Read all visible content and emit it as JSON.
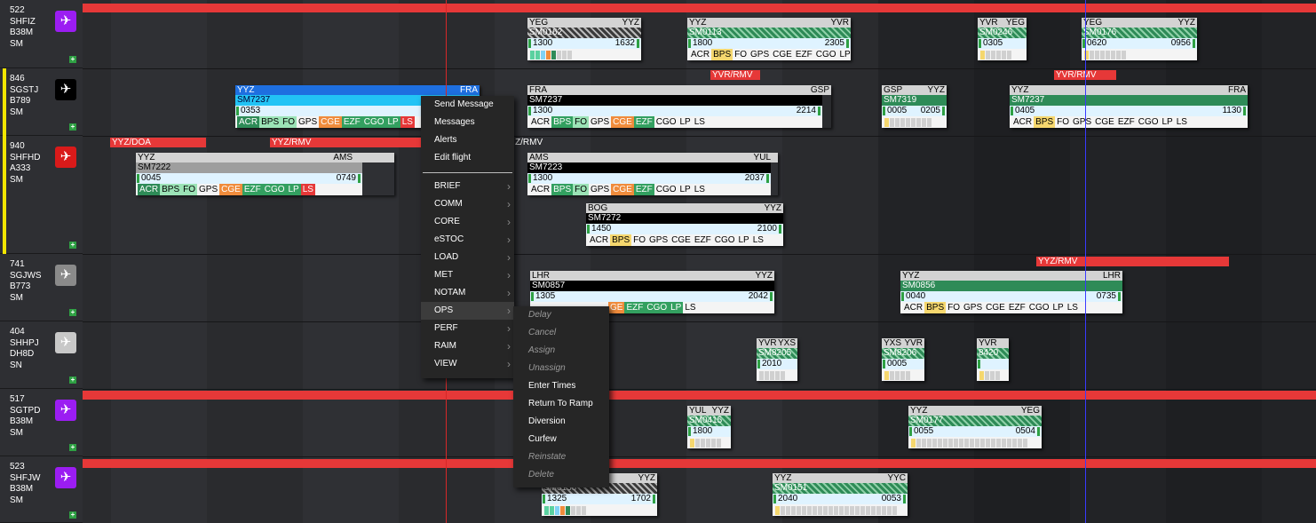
{
  "aircraft": [
    {
      "num": "522",
      "reg": "SHFIZ",
      "type": "B38M",
      "op": "SM",
      "icon_color": "#9b1df2",
      "icon": "airplane-icon"
    },
    {
      "num": "846",
      "reg": "SGSTJ",
      "type": "B789",
      "op": "SM",
      "icon_color": "#000000",
      "icon": "airplane-icon"
    },
    {
      "num": "940",
      "reg": "SHFHD",
      "type": "A333",
      "op": "SM",
      "icon_color": "#d91a1a",
      "icon": "airplane-icon"
    },
    {
      "num": "741",
      "reg": "SGJWS",
      "type": "B773",
      "op": "SM",
      "icon_color": "#8a8a8a",
      "icon": "airplane-icon"
    },
    {
      "num": "404",
      "reg": "SHHPJ",
      "type": "DH8D",
      "op": "SN",
      "icon_color": "#c8c8c8",
      "icon": "airplane-icon"
    },
    {
      "num": "517",
      "reg": "SGTPD",
      "type": "B38M",
      "op": "SM",
      "icon_color": "#9b1df2",
      "icon": "airplane-icon"
    },
    {
      "num": "523",
      "reg": "SHFJW",
      "type": "B38M",
      "op": "SM",
      "icon_color": "#9b1df2",
      "icon": "airplane-icon"
    }
  ],
  "maintenance": {
    "yyz_doa": "YYZ/DOA",
    "yyz_rmv": "YYZ/RMV",
    "z_rmv": "Z/RMV",
    "yvr_rmv": "YVR/RMV",
    "yvr_rmv2": "YVR/RMV",
    "yyz_rmv2": "YYZ/RMV"
  },
  "flights": {
    "f1": {
      "from": "YEG",
      "to": "YYZ",
      "num": "SM0162",
      "dep": "1300",
      "arr": "1632"
    },
    "f2": {
      "from": "YYZ",
      "to": "YVR",
      "num": "SM0113",
      "dep": "1800",
      "arr": "2305",
      "tags": [
        "ACR",
        "BPS",
        "FO",
        "GPS",
        "CGE",
        "EZF",
        "CGO",
        "LP",
        "LS"
      ]
    },
    "f3": {
      "from": "YVR",
      "to": "YEG",
      "num": "SM0246",
      "dep": "0305"
    },
    "f4": {
      "from": "YEG",
      "to": "YYZ",
      "num": "SM0176",
      "dep": "0620",
      "arr": "0956"
    },
    "f5": {
      "from": "YYZ",
      "to": "FRA",
      "num": "SM7237",
      "dep": "0353",
      "tags": [
        "ACR",
        "BPS",
        "FO",
        "GPS",
        "CGE",
        "EZF",
        "CGO",
        "LP",
        "LS"
      ]
    },
    "f6": {
      "from": "FRA",
      "to": "GSP",
      "num": "SM7237",
      "dep": "1300",
      "arr": "2214",
      "tags": [
        "ACR",
        "BPS",
        "FO",
        "GPS",
        "CGE",
        "EZF",
        "CGO",
        "LP",
        "LS"
      ]
    },
    "f7": {
      "from": "GSP",
      "to": "YYZ",
      "num": "SM7319",
      "dep": "0005",
      "arr": "0205"
    },
    "f8": {
      "from": "YYZ",
      "to": "FRA",
      "num": "SM7237",
      "dep": "0405",
      "arr": "1130",
      "tags": [
        "ACR",
        "BPS",
        "FO",
        "GPS",
        "CGE",
        "EZF",
        "CGO",
        "LP",
        "LS"
      ]
    },
    "f9": {
      "from": "YYZ",
      "to": "AMS",
      "num": "SM7222",
      "dep": "0045",
      "arr": "0749",
      "tags": [
        "ACR",
        "BPS",
        "FO",
        "GPS",
        "CGE",
        "EZF",
        "CGO",
        "LP",
        "LS"
      ]
    },
    "f10": {
      "from": "AMS",
      "to": "YUL",
      "num": "SM7223",
      "dep": "1300",
      "arr": "2037",
      "tags": [
        "ACR",
        "BPS",
        "FO",
        "GPS",
        "CGE",
        "EZF",
        "CGO",
        "LP",
        "LS"
      ]
    },
    "f11": {
      "from": "BOG",
      "to": "YYZ",
      "num": "SM7272",
      "dep": "1450",
      "arr": "2100",
      "tags": [
        "ACR",
        "BPS",
        "FO",
        "GPS",
        "CGE",
        "EZF",
        "CGO",
        "LP",
        "LS"
      ]
    },
    "f12": {
      "from": "LHR",
      "to": "YYZ",
      "num": "SM0857",
      "dep": "1305",
      "arr": "2042",
      "tags": [
        "GE",
        "EZF",
        "CGO",
        "LP",
        "LS"
      ]
    },
    "f13": {
      "from": "YYZ",
      "to": "LHR",
      "num": "SM0856",
      "dep": "0040",
      "arr": "0735",
      "tags": [
        "ACR",
        "BPS",
        "FO",
        "GPS",
        "CGE",
        "EZF",
        "CGO",
        "LP",
        "LS"
      ]
    },
    "f14": {
      "from": "YVR",
      "to": "YXS",
      "num": "SM8205",
      "dep": "2010"
    },
    "f15": {
      "from": "YXS",
      "to": "YVR",
      "num": "SM8206",
      "dep": "0005"
    },
    "f16": {
      "from": "YVR",
      "to": "",
      "num": "8420"
    },
    "f17": {
      "from": "YUL",
      "to": "YYZ",
      "num": "SM0415",
      "dep": "1800"
    },
    "f18": {
      "from": "YYZ",
      "to": "YEG",
      "num": "SM0177",
      "dep": "0055",
      "arr": "0504"
    },
    "f19": {
      "from": "",
      "to": "YYZ",
      "num": "SM0138",
      "dep": "1325",
      "arr": "1702"
    },
    "f20": {
      "from": "YYZ",
      "to": "YYC",
      "num": "SM0151",
      "dep": "2040",
      "arr": "0053"
    }
  },
  "context_menu": {
    "items_top": [
      "Send Message",
      "Messages",
      "Alerts",
      "Edit flight"
    ],
    "items_sub": [
      "BRIEF",
      "COMM",
      "CORE",
      "eSTOC",
      "LOAD",
      "MET",
      "NOTAM",
      "OPS",
      "PERF",
      "RAIM",
      "VIEW"
    ],
    "highlighted": "OPS"
  },
  "ops_submenu": {
    "items": [
      {
        "label": "Delay",
        "enabled": false
      },
      {
        "label": "Cancel",
        "enabled": false
      },
      {
        "label": "Assign",
        "enabled": false
      },
      {
        "label": "Unassign",
        "enabled": false
      },
      {
        "label": "Enter Times",
        "enabled": true
      },
      {
        "label": "Return To Ramp",
        "enabled": true
      },
      {
        "label": "Diversion",
        "enabled": true
      },
      {
        "label": "Curfew",
        "enabled": true
      },
      {
        "label": "Reinstate",
        "enabled": false
      },
      {
        "label": "Delete",
        "enabled": false
      }
    ]
  },
  "colors": {
    "accent_red": "#e63838",
    "current_time_line": "#d62828",
    "now_line": "#3a3aff"
  }
}
